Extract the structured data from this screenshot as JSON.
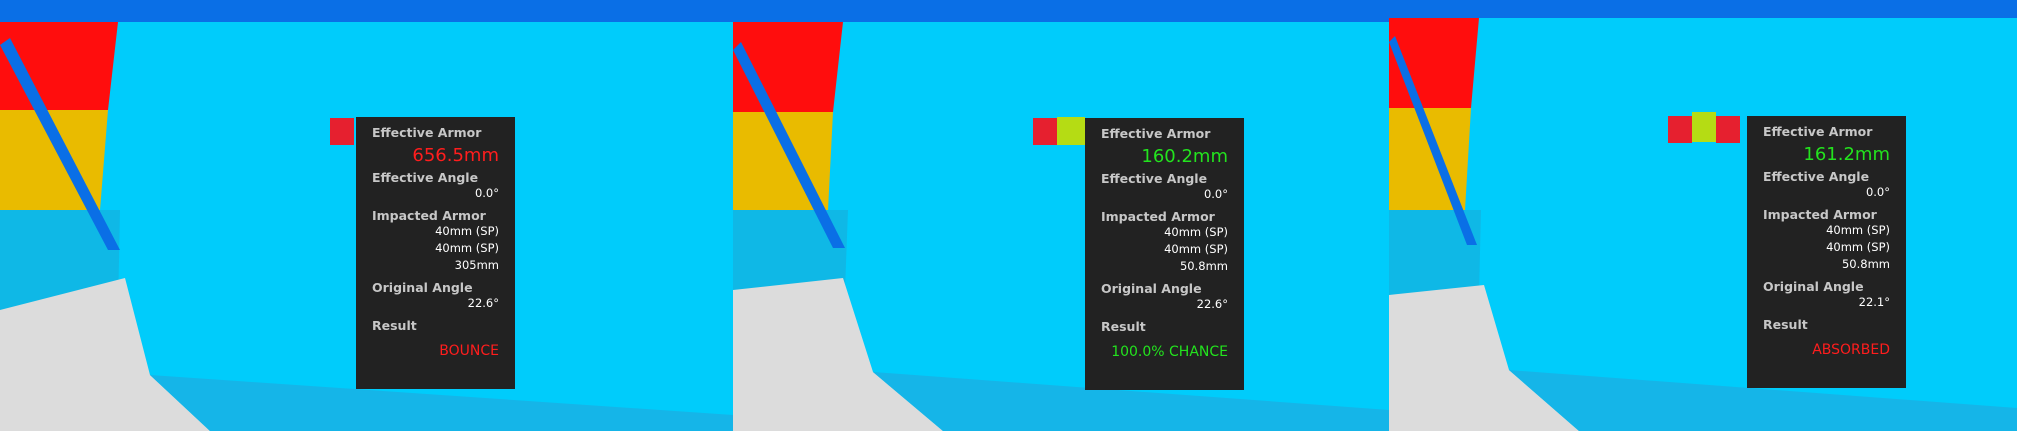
{
  "colors": {
    "red": "#e6202f",
    "lime": "#b5dc14",
    "tooltip_bg": "#222222",
    "bounce": "#ff1d1d",
    "chance": "#23e31e"
  },
  "panels": [
    {
      "effective_armor_label": "Effective Armor",
      "effective_armor": "656.5mm",
      "effective_angle_label": "Effective Angle",
      "effective_angle": "0.0°",
      "impacted_armor_label": "Impacted Armor",
      "impacted_armor": [
        "40mm (SP)",
        "40mm (SP)",
        "305mm"
      ],
      "original_angle_label": "Original Angle",
      "original_angle": "22.6°",
      "result_label": "Result",
      "result": "BOUNCE"
    },
    {
      "effective_armor_label": "Effective Armor",
      "effective_armor": "160.2mm",
      "effective_angle_label": "Effective Angle",
      "effective_angle": "0.0°",
      "impacted_armor_label": "Impacted Armor",
      "impacted_armor": [
        "40mm (SP)",
        "40mm (SP)",
        "50.8mm"
      ],
      "original_angle_label": "Original Angle",
      "original_angle": "22.6°",
      "result_label": "Result",
      "result": "100.0% CHANCE"
    },
    {
      "effective_armor_label": "Effective Armor",
      "effective_armor": "161.2mm",
      "effective_angle_label": "Effective Angle",
      "effective_angle": "0.0°",
      "impacted_armor_label": "Impacted Armor",
      "impacted_armor": [
        "40mm (SP)",
        "40mm (SP)",
        "50.8mm"
      ],
      "original_angle_label": "Original Angle",
      "original_angle": "22.1°",
      "result_label": "Result",
      "result": "ABSORBED"
    }
  ]
}
